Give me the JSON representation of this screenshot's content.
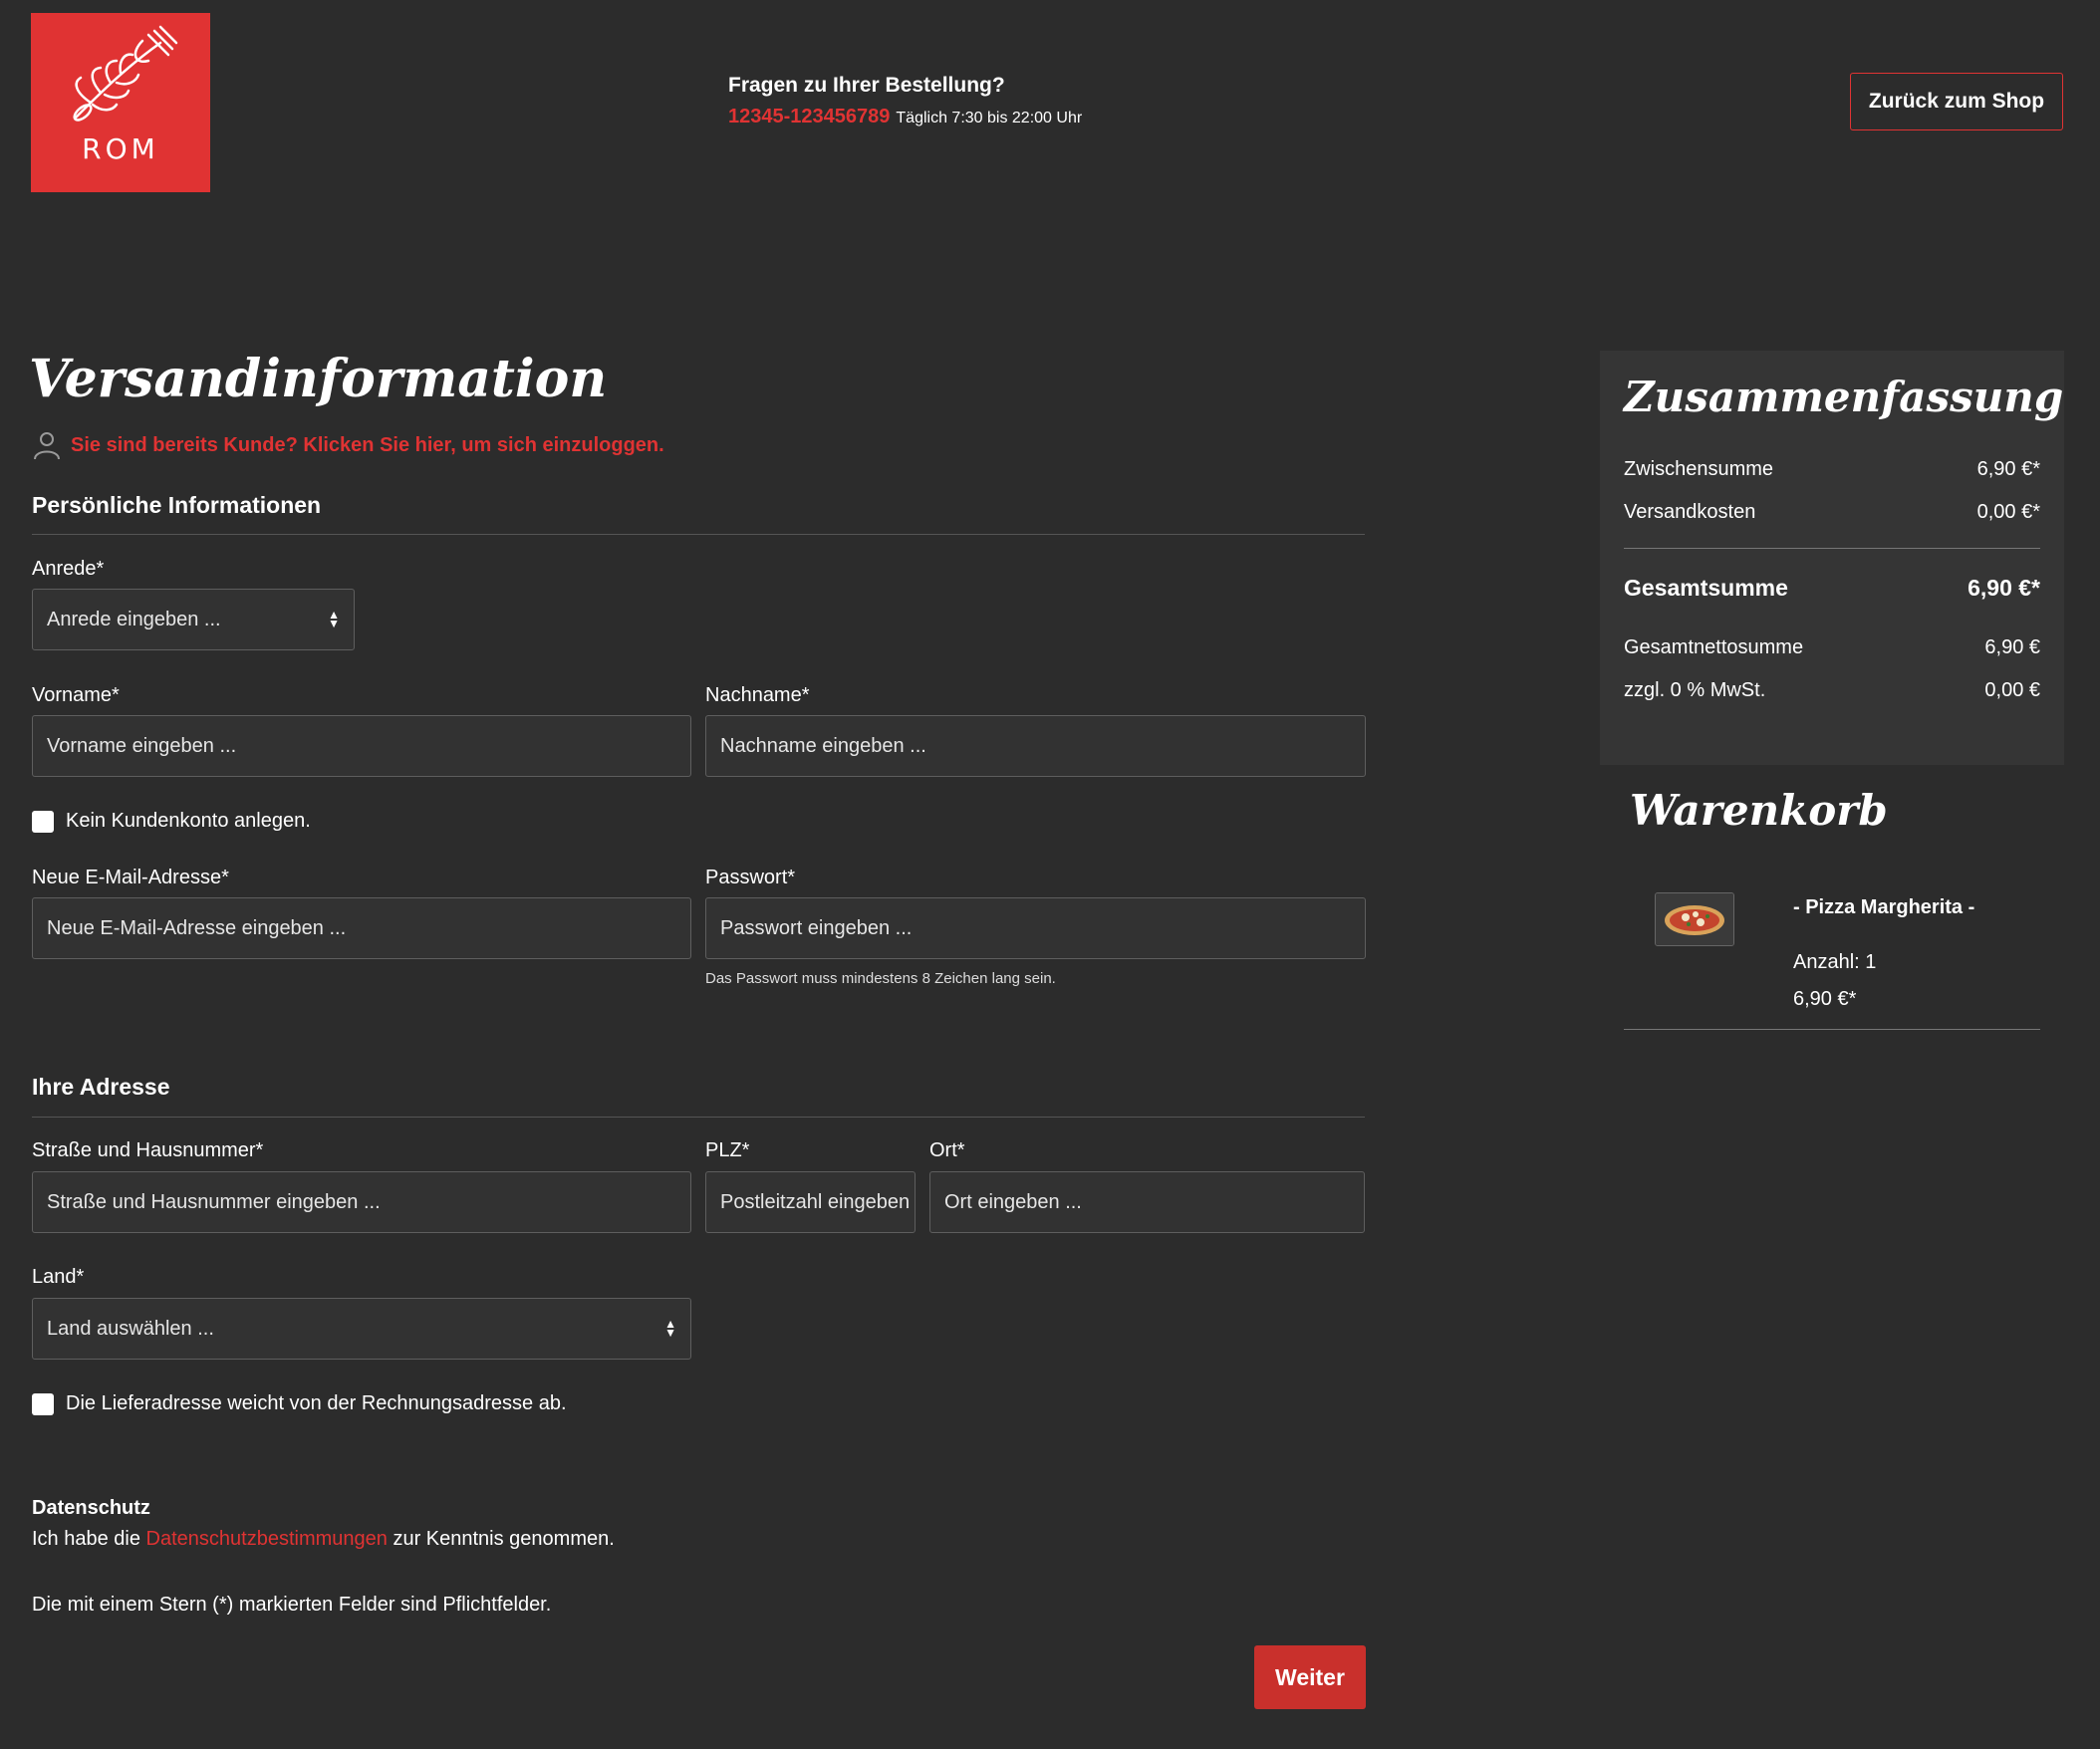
{
  "header": {
    "logo_text": "ROM",
    "hotline_title": "Fragen zu Ihrer Bestellung?",
    "hotline_phone": "12345-123456789",
    "hotline_hours": "Täglich 7:30 bis 22:00 Uhr",
    "back_button": "Zurück zum Shop"
  },
  "colors": {
    "accent": "#e03333",
    "background": "#2c2c2c",
    "panel": "#353535"
  },
  "form": {
    "title": "Versandinformation",
    "login_link": "Sie sind bereits Kunde? Klicken Sie hier, um sich einzuloggen.",
    "personal_title": "Persönliche Informationen",
    "salutation_label": "Anrede*",
    "salutation_value": "Anrede eingeben ...",
    "firstname_label": "Vorname*",
    "firstname_placeholder": "Vorname eingeben ...",
    "lastname_label": "Nachname*",
    "lastname_placeholder": "Nachname eingeben ...",
    "no_account_label": "Kein Kundenkonto anlegen.",
    "email_label": "Neue E-Mail-Adresse*",
    "email_placeholder": "Neue E-Mail-Adresse eingeben ...",
    "password_label": "Passwort*",
    "password_placeholder": "Passwort eingeben ...",
    "password_hint": "Das Passwort muss mindestens 8 Zeichen lang sein.",
    "address_title": "Ihre Adresse",
    "street_label": "Straße und Hausnummer*",
    "street_placeholder": "Straße und Hausnummer eingeben ...",
    "zip_label": "PLZ*",
    "zip_placeholder": "Postleitzahl eingeben ...",
    "city_label": "Ort*",
    "city_placeholder": "Ort eingeben ...",
    "country_label": "Land*",
    "country_value": "Land auswählen ...",
    "different_shipping_label": "Die Lieferadresse weicht von der Rechnungsadresse ab.",
    "privacy_title": "Datenschutz",
    "privacy_prefix": "Ich habe die ",
    "privacy_link": "Datenschutzbestimmungen",
    "privacy_suffix": " zur Kenntnis genommen.",
    "required_note": "Die mit einem Stern (*) markierten Felder sind Pflichtfelder.",
    "submit_button": "Weiter"
  },
  "summary": {
    "title": "Zusammenfassung",
    "rows": [
      {
        "label": "Zwischensumme",
        "value": "6,90 €*"
      },
      {
        "label": "Versandkosten",
        "value": "0,00 €*"
      }
    ],
    "total_label": "Gesamtsumme",
    "total_value": "6,90 €*",
    "net_label": "Gesamtnettosumme",
    "net_value": "6,90 €",
    "tax_label": "zzgl. 0 % MwSt.",
    "tax_value": "0,00 €"
  },
  "cart": {
    "title": "Warenkorb",
    "item_name": "- Pizza Margherita -",
    "item_qty": "Anzahl: 1",
    "item_price": "6,90 €*"
  }
}
